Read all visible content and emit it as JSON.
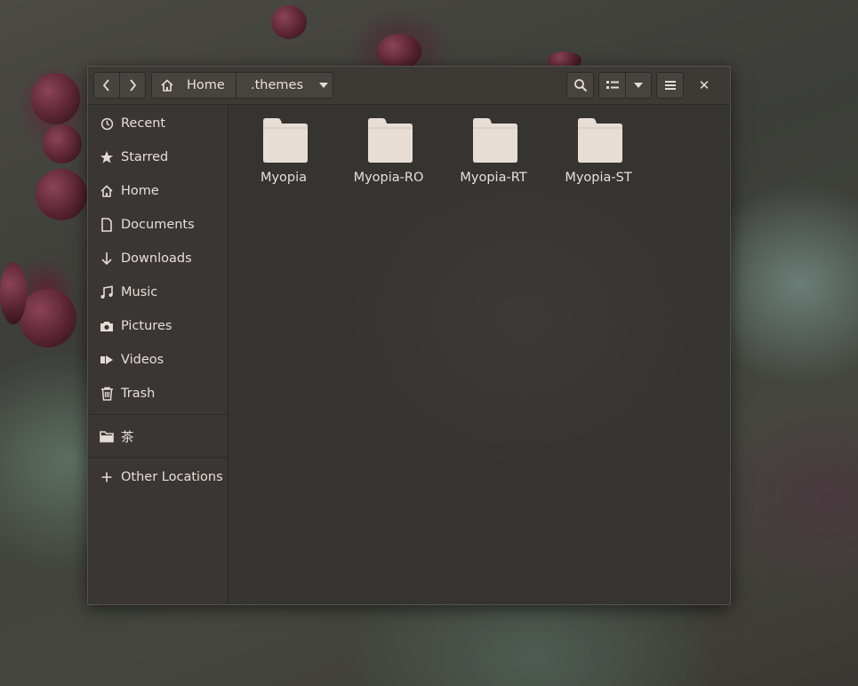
{
  "window": {
    "path": {
      "home_label": "Home",
      "current_label": ".themes"
    },
    "buttons": {
      "back_icon": "chevron-left",
      "forward_icon": "chevron-right",
      "search_icon": "magnifier",
      "view_icon": "list-view",
      "view_dropdown_icon": "caret-down",
      "menu_icon": "hamburger",
      "close_glyph": "✕"
    }
  },
  "sidebar": {
    "items": [
      {
        "label": "Recent",
        "icon": "clock-icon"
      },
      {
        "label": "Starred",
        "icon": "star-icon"
      },
      {
        "label": "Home",
        "icon": "home-icon"
      },
      {
        "label": "Documents",
        "icon": "document-icon"
      },
      {
        "label": "Downloads",
        "icon": "download-icon"
      },
      {
        "label": "Music",
        "icon": "music-icon"
      },
      {
        "label": "Pictures",
        "icon": "camera-icon"
      },
      {
        "label": "Videos",
        "icon": "video-icon"
      },
      {
        "label": "Trash",
        "icon": "trash-icon"
      }
    ],
    "bookmarks": [
      {
        "label": "茶",
        "icon": "folder-icon"
      }
    ],
    "other": {
      "label": "Other Locations",
      "icon": "plus-icon"
    }
  },
  "content": {
    "folders": [
      {
        "name": "Myopia"
      },
      {
        "name": "Myopia-RO"
      },
      {
        "name": "Myopia-RT"
      },
      {
        "name": "Myopia-ST"
      }
    ]
  },
  "colors": {
    "folder": "#e8ddd5",
    "window_bg": "#3a3733",
    "text": "#e6e0da"
  }
}
